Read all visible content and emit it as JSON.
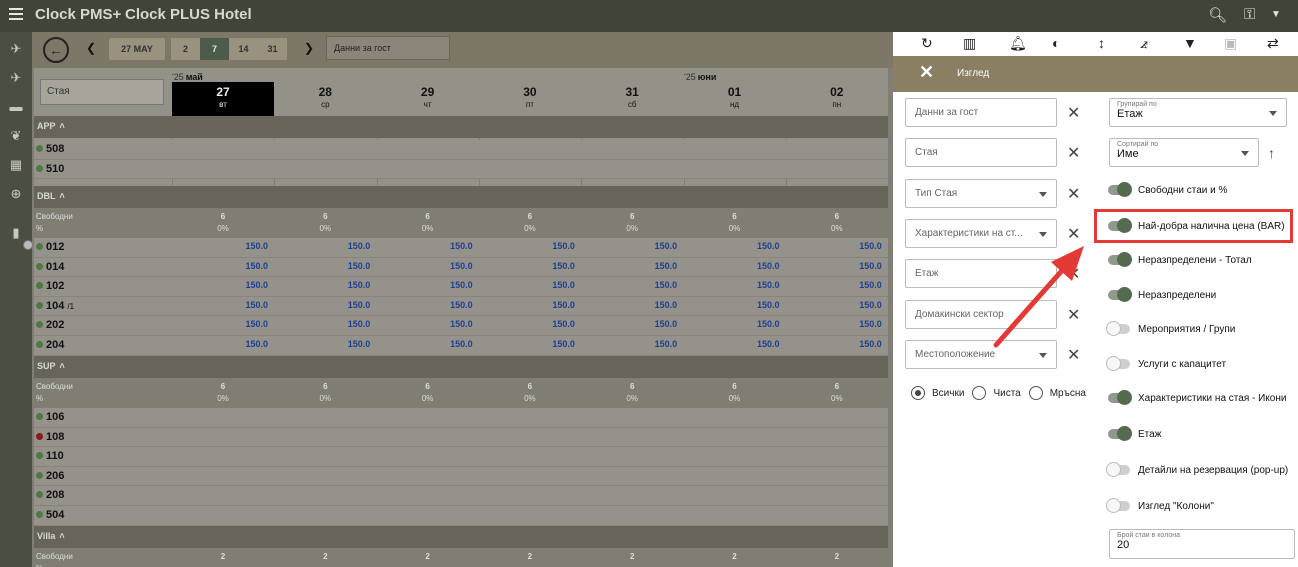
{
  "app": {
    "name": "Clock PMS+",
    "hotel": "Clock PLUS Hotel"
  },
  "controls": {
    "date_button": "27 MAY",
    "ranges": [
      "2",
      "7",
      "14",
      "31"
    ],
    "active_range": "7",
    "guest_search_placeholder": "Данни за гост"
  },
  "grid": {
    "room_search_placeholder": "Стая",
    "months": [
      {
        "year": "'25",
        "name": "май"
      },
      {
        "year": "'25",
        "name": "юни"
      }
    ],
    "days": [
      {
        "d": "27",
        "w": "вт"
      },
      {
        "d": "28",
        "w": "ср"
      },
      {
        "d": "29",
        "w": "чт"
      },
      {
        "d": "30",
        "w": "пт"
      },
      {
        "d": "31",
        "w": "сб"
      },
      {
        "d": "01",
        "w": "нд"
      },
      {
        "d": "02",
        "w": "пн"
      }
    ],
    "summary_labels": {
      "free": "Свободни",
      "pct": "%"
    },
    "groups": [
      {
        "name": "APP",
        "rooms": [
          {
            "n": "508",
            "status": "clean"
          },
          {
            "n": "510",
            "status": "clean"
          }
        ]
      },
      {
        "name": "DBL",
        "free": [
          "6",
          "6",
          "6",
          "6",
          "6",
          "6",
          "6"
        ],
        "pct": [
          "0%",
          "0%",
          "0%",
          "0%",
          "0%",
          "0%",
          "0%"
        ],
        "rooms": [
          {
            "n": "012",
            "status": "clean",
            "price": "150.0"
          },
          {
            "n": "014",
            "status": "clean",
            "price": "150.0"
          },
          {
            "n": "102",
            "status": "clean",
            "price": "150.0"
          },
          {
            "n": "104",
            "status": "clean",
            "price": "150.0",
            "note": "/1"
          },
          {
            "n": "202",
            "status": "clean",
            "price": "150.0"
          },
          {
            "n": "204",
            "status": "clean",
            "price": "150.0"
          }
        ]
      },
      {
        "name": "SUP",
        "free": [
          "6",
          "6",
          "6",
          "6",
          "6",
          "6",
          "6"
        ],
        "pct": [
          "0%",
          "0%",
          "0%",
          "0%",
          "0%",
          "0%",
          "0%"
        ],
        "rooms": [
          {
            "n": "106",
            "status": "clean"
          },
          {
            "n": "108",
            "status": "dirty"
          },
          {
            "n": "110",
            "status": "clean"
          },
          {
            "n": "206",
            "status": "clean"
          },
          {
            "n": "208",
            "status": "clean"
          },
          {
            "n": "504",
            "status": "clean"
          }
        ]
      },
      {
        "name": "Villa",
        "free": [
          "2",
          "2",
          "2",
          "2",
          "2",
          "2",
          "2"
        ]
      }
    ]
  },
  "panel": {
    "title": "Изглед",
    "filters": [
      {
        "label": "Данни за гост",
        "select": false
      },
      {
        "label": "Стая",
        "select": false
      },
      {
        "label": "Тип Стая",
        "select": true
      },
      {
        "label": "Характеристики на ст...",
        "select": true
      },
      {
        "label": "Етаж",
        "select": false
      },
      {
        "label": "Домакински сектор",
        "select": false
      },
      {
        "label": "Местоположение",
        "select": true
      }
    ],
    "status_radios": [
      {
        "label": "Всички",
        "checked": true
      },
      {
        "label": "Чиста",
        "checked": false
      },
      {
        "label": "Мръсна",
        "checked": false
      }
    ],
    "group_by": {
      "label": "Групирай по",
      "value": "Етаж"
    },
    "sort_by": {
      "label": "Сортирай по",
      "value": "Име"
    },
    "toggles": [
      {
        "label": "Свободни стаи и %",
        "on": true
      },
      {
        "label": "Най-добра налична цена (BAR)",
        "on": true
      },
      {
        "label": "Неразпределени - Тотал",
        "on": true
      },
      {
        "label": "Неразпределени",
        "on": true
      },
      {
        "label": "Мероприятия / Групи",
        "on": false
      },
      {
        "label": "Услуги с капацитет",
        "on": false
      },
      {
        "label": "Характеристики на стая - Икони",
        "on": true
      },
      {
        "label": "Етаж",
        "on": true
      },
      {
        "label": "Детайли на резервация (pop-up)",
        "on": false
      },
      {
        "label": "Изглед \"Колони\"",
        "on": false
      }
    ],
    "rooms_per_column": {
      "label": "Брой стаи в колона",
      "value": "20"
    }
  },
  "colors": {
    "topbar": "#3f4537",
    "panel_header": "#8a7f62",
    "price": "#1f3f92",
    "highlight": "#e53935"
  }
}
